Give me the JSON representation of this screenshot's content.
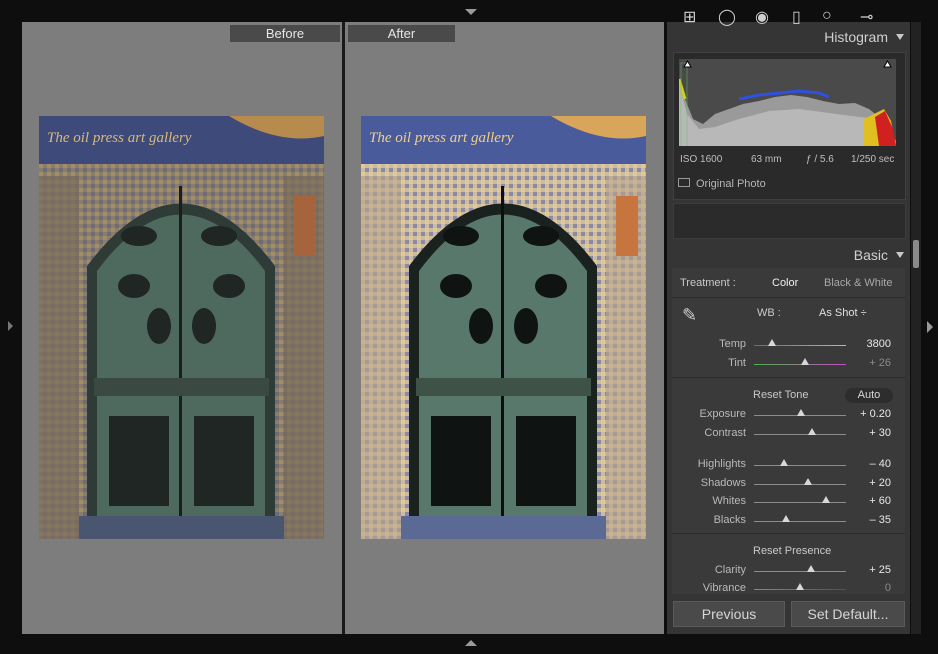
{
  "compare": {
    "before_label": "Before",
    "after_label": "After"
  },
  "photo": {
    "caption": "The oil press art gallery"
  },
  "histogram": {
    "title": "Histogram",
    "iso": "ISO 1600",
    "focal": "63 mm",
    "aperture": "ƒ / 5.6",
    "shutter": "1/250 sec",
    "original_photo": "Original Photo"
  },
  "basic": {
    "title": "Basic",
    "treatment_label": "Treatment :",
    "color": "Color",
    "bw": "Black & White",
    "wb_label": "WB :",
    "wb_value": "As Shot ÷",
    "temp_label": "Temp",
    "temp_value": "3800",
    "tint_label": "Tint",
    "tint_value": "+ 26",
    "reset_tone": "Reset Tone",
    "auto": "Auto",
    "exposure_label": "Exposure",
    "exposure_value": "+ 0.20",
    "contrast_label": "Contrast",
    "contrast_value": "+ 30",
    "highlights_label": "Highlights",
    "highlights_value": "– 40",
    "shadows_label": "Shadows",
    "shadows_value": "+ 20",
    "whites_label": "Whites",
    "whites_value": "+ 60",
    "blacks_label": "Blacks",
    "blacks_value": "– 35",
    "reset_presence": "Reset Presence",
    "clarity_label": "Clarity",
    "clarity_value": "+ 25",
    "vibrance_label": "Vibrance",
    "vibrance_value": "0"
  },
  "slider_levels": {
    "temp": 0.2,
    "tint": 0.55,
    "exposure": 0.51,
    "contrast": 0.63,
    "highlights": 0.33,
    "shadows": 0.59,
    "whites": 0.78,
    "blacks": 0.35,
    "clarity": 0.62,
    "vibrance": 0.5
  },
  "buttons": {
    "previous": "Previous",
    "set_default": "Set Default..."
  }
}
